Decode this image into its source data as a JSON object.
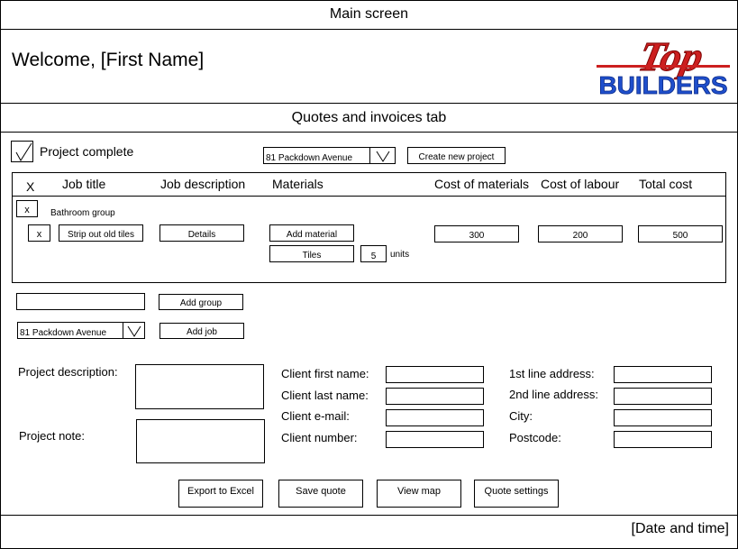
{
  "header": {
    "title": "Main screen"
  },
  "welcome": {
    "text": "Welcome, [First Name]"
  },
  "logo": {
    "top": "Top",
    "bottom": "BUILDERS",
    "colors": {
      "top": "#cc1f1f",
      "bottom": "#1f4fcc"
    }
  },
  "tab": {
    "title": "Quotes and invoices tab"
  },
  "project_complete": {
    "label": "Project complete"
  },
  "project_select": {
    "value": "81 Packdown Avenue"
  },
  "create_project": {
    "label": "Create new project"
  },
  "table": {
    "headers": {
      "x": "X",
      "job_title": "Job title",
      "job_description": "Job description",
      "materials": "Materials",
      "cost_materials": "Cost of materials",
      "cost_labour": "Cost of labour",
      "total_cost": "Total cost"
    },
    "group": {
      "remove": "x",
      "name": "Bathroom group"
    },
    "job": {
      "remove": "x",
      "title": "Strip out old tiles",
      "details": "Details",
      "add_material": "Add material",
      "material": "Tiles",
      "quantity": "5",
      "units": "units",
      "cost_materials": "300",
      "cost_labour": "200",
      "total_cost": "500"
    }
  },
  "add_group": {
    "input_value": "",
    "label": "Add group"
  },
  "job_project_select": {
    "value": "81 Packdown Avenue"
  },
  "add_job": {
    "label": "Add job"
  },
  "form": {
    "project_description": "Project description:",
    "project_note": "Project note:",
    "client_first_name": "Client first name:",
    "client_last_name": "Client last name:",
    "client_email": "Client e-mail:",
    "client_number": "Client number:",
    "address_line1": "1st line address:",
    "address_line2": "2nd line address:",
    "city": "City:",
    "postcode": "Postcode:"
  },
  "actions": {
    "export": "Export to Excel",
    "save": "Save quote",
    "map": "View map",
    "settings": "Quote settings"
  },
  "footer": {
    "datetime": "[Date and time]"
  }
}
